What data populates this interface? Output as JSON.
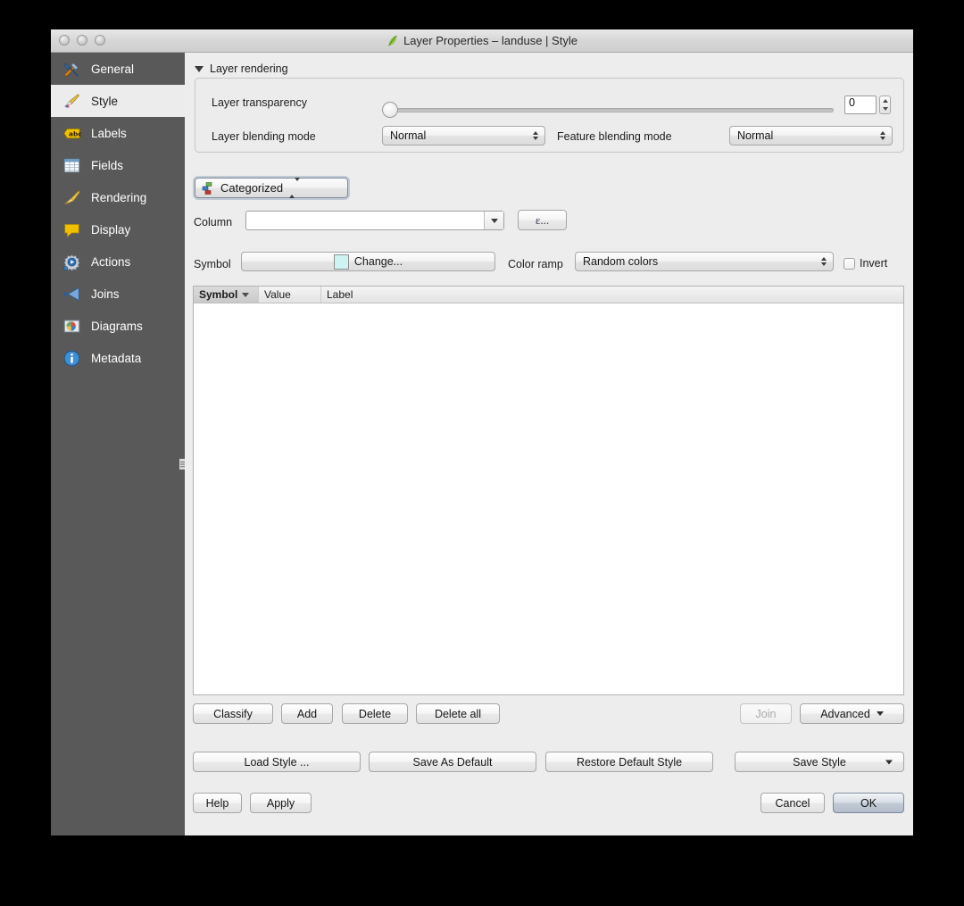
{
  "window": {
    "title": "Layer Properties – landuse | Style",
    "title_icon": "qgis-leaf-icon",
    "traffic_lights": [
      "close-button",
      "minimize-button",
      "zoom-button"
    ]
  },
  "sidebar": {
    "items": [
      {
        "label": "General",
        "icon": "tools-icon",
        "selected": false
      },
      {
        "label": "Style",
        "icon": "brush-icon",
        "selected": true
      },
      {
        "label": "Labels",
        "icon": "abc-label-icon",
        "selected": false
      },
      {
        "label": "Fields",
        "icon": "table-icon",
        "selected": false
      },
      {
        "label": "Rendering",
        "icon": "broom-icon",
        "selected": false
      },
      {
        "label": "Display",
        "icon": "speech-bubble-icon",
        "selected": false
      },
      {
        "label": "Actions",
        "icon": "gear-play-icon",
        "selected": false
      },
      {
        "label": "Joins",
        "icon": "join-arrow-icon",
        "selected": false
      },
      {
        "label": "Diagrams",
        "icon": "pie-chart-icon",
        "selected": false
      },
      {
        "label": "Metadata",
        "icon": "info-icon",
        "selected": false
      }
    ]
  },
  "layer_rendering": {
    "group_title": "Layer rendering",
    "collapse_icon": "triangle-down-icon",
    "transparency_label": "Layer transparency",
    "transparency_value": "0",
    "transparency_slider_percent": 0,
    "layer_blending_label": "Layer blending mode",
    "layer_blending_value": "Normal",
    "feature_blending_label": "Feature blending mode",
    "feature_blending_value": "Normal"
  },
  "style": {
    "renderer_value": "Categorized",
    "renderer_icon": "categorized-icon",
    "column_label": "Column",
    "column_value": "",
    "column_dropdown_icon": "chevron-down-icon",
    "expression_button_label": "ε...",
    "symbol_label": "Symbol",
    "symbol_change_label": "Change...",
    "symbol_swatch_color": "#cdf3f3",
    "color_ramp_label": "Color ramp",
    "color_ramp_value": "Random colors",
    "invert_label": "Invert",
    "invert_checked": false
  },
  "table": {
    "columns": [
      {
        "key": "symbol",
        "label": "Symbol",
        "sorted": true,
        "sort_icon": "triangle-down-icon"
      },
      {
        "key": "value",
        "label": "Value",
        "sorted": false
      },
      {
        "key": "label",
        "label": "Label",
        "sorted": false
      }
    ],
    "rows": []
  },
  "actions": {
    "classify": "Classify",
    "add": "Add",
    "delete": "Delete",
    "delete_all": "Delete all",
    "join": "Join",
    "join_disabled": true,
    "advanced": "Advanced",
    "advanced_menu_icon": "triangle-down-icon"
  },
  "style_buttons": {
    "load_style": "Load Style ...",
    "save_as_default": "Save As Default",
    "restore_default_style": "Restore Default Style",
    "save_style": "Save Style",
    "save_style_menu_icon": "triangle-down-icon"
  },
  "dialog_buttons": {
    "help": "Help",
    "apply": "Apply",
    "cancel": "Cancel",
    "ok": "OK",
    "default_button": "ok"
  }
}
